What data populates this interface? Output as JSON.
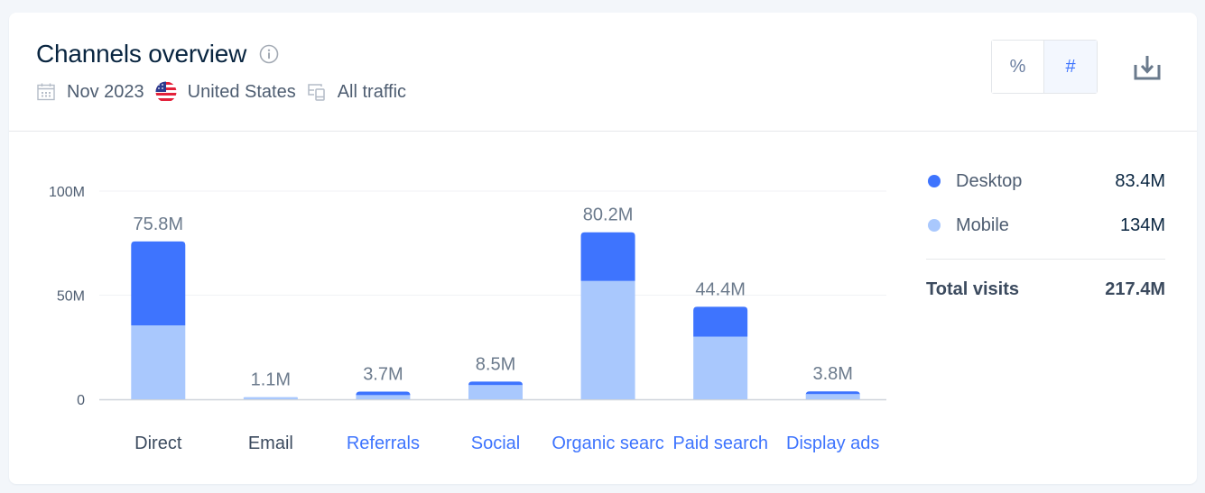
{
  "header": {
    "title": "Channels overview",
    "info_icon": "info-circle-icon",
    "meta": {
      "date": "Nov 2023",
      "date_icon": "calendar-icon",
      "country": "United States",
      "country_icon": "us-flag-icon",
      "traffic": "All traffic",
      "traffic_icon": "devices-icon"
    },
    "toggle": {
      "options": [
        "%",
        "#"
      ],
      "selected": "#"
    },
    "download_icon": "download-icon"
  },
  "colors": {
    "desktop": "#3e74fe",
    "mobile": "#a9c8fd",
    "link": "#3e74fe",
    "axis_text": "#4e5d71"
  },
  "legend": {
    "items": [
      {
        "label": "Desktop",
        "value": "83.4M",
        "color": "#3e74fe"
      },
      {
        "label": "Mobile",
        "value": "134M",
        "color": "#a9c8fd"
      }
    ],
    "total_label": "Total visits",
    "total_value": "217.4M"
  },
  "chart_data": {
    "type": "bar",
    "stacked": true,
    "title": "Channels overview",
    "xlabel": "",
    "ylabel": "",
    "ylim": [
      0,
      100
    ],
    "yunit": "M",
    "yticks": [
      {
        "value": 0,
        "label": "0"
      },
      {
        "value": 50,
        "label": "50M"
      },
      {
        "value": 100,
        "label": "100M"
      }
    ],
    "grid": true,
    "legend_position": "right",
    "categories": [
      "Direct",
      "Email",
      "Referrals",
      "Social",
      "Organic search",
      "Paid search",
      "Display ads"
    ],
    "category_display": [
      "Direct",
      "Email",
      "Referrals",
      "Social",
      "Organic searc",
      "Paid search",
      "Display ads"
    ],
    "category_is_link": [
      false,
      false,
      true,
      true,
      true,
      true,
      true
    ],
    "series": [
      {
        "name": "Mobile",
        "values": [
          35.5,
          0.9,
          2.0,
          6.8,
          56.8,
          30.1,
          2.5
        ]
      },
      {
        "name": "Desktop",
        "values": [
          40.3,
          0.2,
          1.7,
          1.7,
          23.4,
          14.3,
          1.3
        ]
      }
    ],
    "totals": [
      75.8,
      1.1,
      3.7,
      8.5,
      80.2,
      44.4,
      3.8
    ],
    "total_labels": [
      "75.8M",
      "1.1M",
      "3.7M",
      "8.5M",
      "80.2M",
      "44.4M",
      "3.8M"
    ]
  }
}
